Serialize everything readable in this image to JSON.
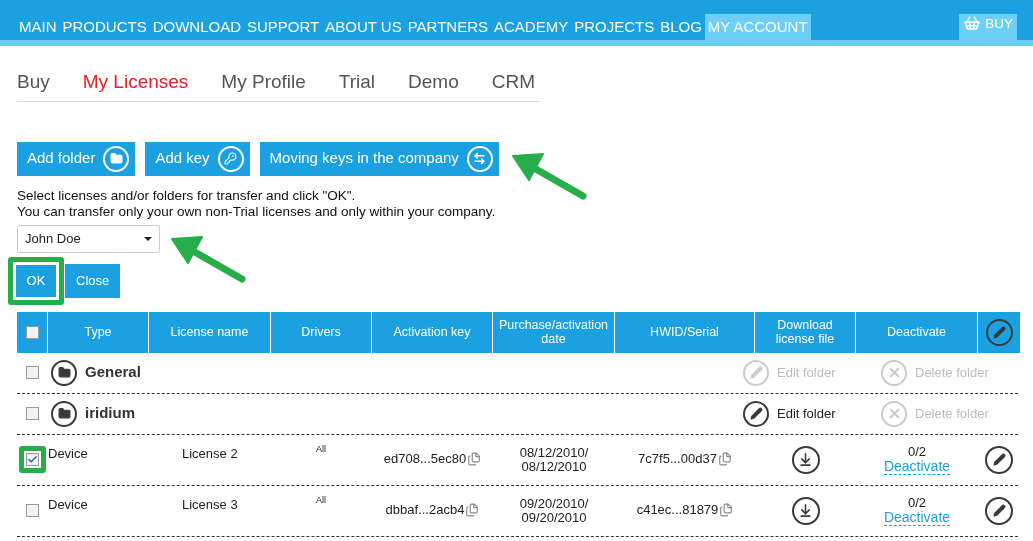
{
  "nav": {
    "items": [
      {
        "label": "MAIN",
        "selected": false
      },
      {
        "label": "PRODUCTS",
        "selected": false
      },
      {
        "label": "DOWNLOAD",
        "selected": false
      },
      {
        "label": "SUPPORT",
        "selected": false
      },
      {
        "label": "ABOUT US",
        "selected": false
      },
      {
        "label": "PARTNERS",
        "selected": false
      },
      {
        "label": "ACADEMY",
        "selected": false
      },
      {
        "label": "PROJECTS",
        "selected": false
      },
      {
        "label": "BLOG",
        "selected": false
      },
      {
        "label": "MY ACCOUNT",
        "selected": true
      }
    ],
    "buy_button": "BUY"
  },
  "tabs": [
    {
      "label": "Buy",
      "selected": false
    },
    {
      "label": "My Licenses",
      "selected": true
    },
    {
      "label": "My Profile",
      "selected": false
    },
    {
      "label": "Trial",
      "selected": false
    },
    {
      "label": "Demo",
      "selected": false
    },
    {
      "label": "CRM",
      "selected": false
    }
  ],
  "actions": [
    {
      "label": "Add folder",
      "kind": "folder",
      "pointed_at": false
    },
    {
      "label": "Add key",
      "kind": "key",
      "pointed_at": false
    },
    {
      "label": "Moving keys in the company",
      "kind": "move",
      "pointed_at": true
    }
  ],
  "transfer": {
    "instructions": [
      "Select licenses and/or folders for transfer and click \"OK\".",
      "You can transfer only your own non-Trial licenses and only within your company."
    ],
    "select": {
      "value": "John Doe",
      "pointed_at": true
    },
    "ok_button": {
      "label": "OK",
      "highlighted": true
    },
    "close_button": "Close"
  },
  "table": {
    "all_checked": false,
    "columns": [
      "Type",
      "License name",
      "Drivers",
      "Activation key",
      "Purchase/activation date",
      "HWID/Serial",
      "Download license file",
      "Deactivate"
    ],
    "rows": [
      {
        "kind": "folder",
        "checked": false,
        "highlighted": false,
        "name": "General",
        "edit": {
          "label": "Edit folder",
          "disabled": true
        },
        "delete": {
          "label": "Delete folder",
          "disabled": true
        }
      },
      {
        "kind": "folder",
        "checked": false,
        "highlighted": false,
        "name": "iridium",
        "edit": {
          "label": "Edit folder",
          "disabled": false
        },
        "delete": {
          "label": "Delete folder",
          "disabled": true
        }
      },
      {
        "kind": "license",
        "checked": true,
        "highlighted": true,
        "type": "Device",
        "name": "License 2",
        "drivers": "All",
        "activation_key": "ed708...5ec80",
        "dates": [
          "08/12/2010/",
          "08/12/2010"
        ],
        "hwid": "7c7f5...00d37",
        "activations": "0/2",
        "deactivate": "Deactivate"
      },
      {
        "kind": "license",
        "checked": false,
        "highlighted": false,
        "type": "Device",
        "name": "License 3",
        "drivers": "All",
        "activation_key": "dbbaf...2acb4",
        "dates": [
          "09/20/2010/",
          "09/20/2010"
        ],
        "hwid": "c41ec...81879",
        "activations": "0/2",
        "deactivate": "Deactivate"
      }
    ]
  }
}
